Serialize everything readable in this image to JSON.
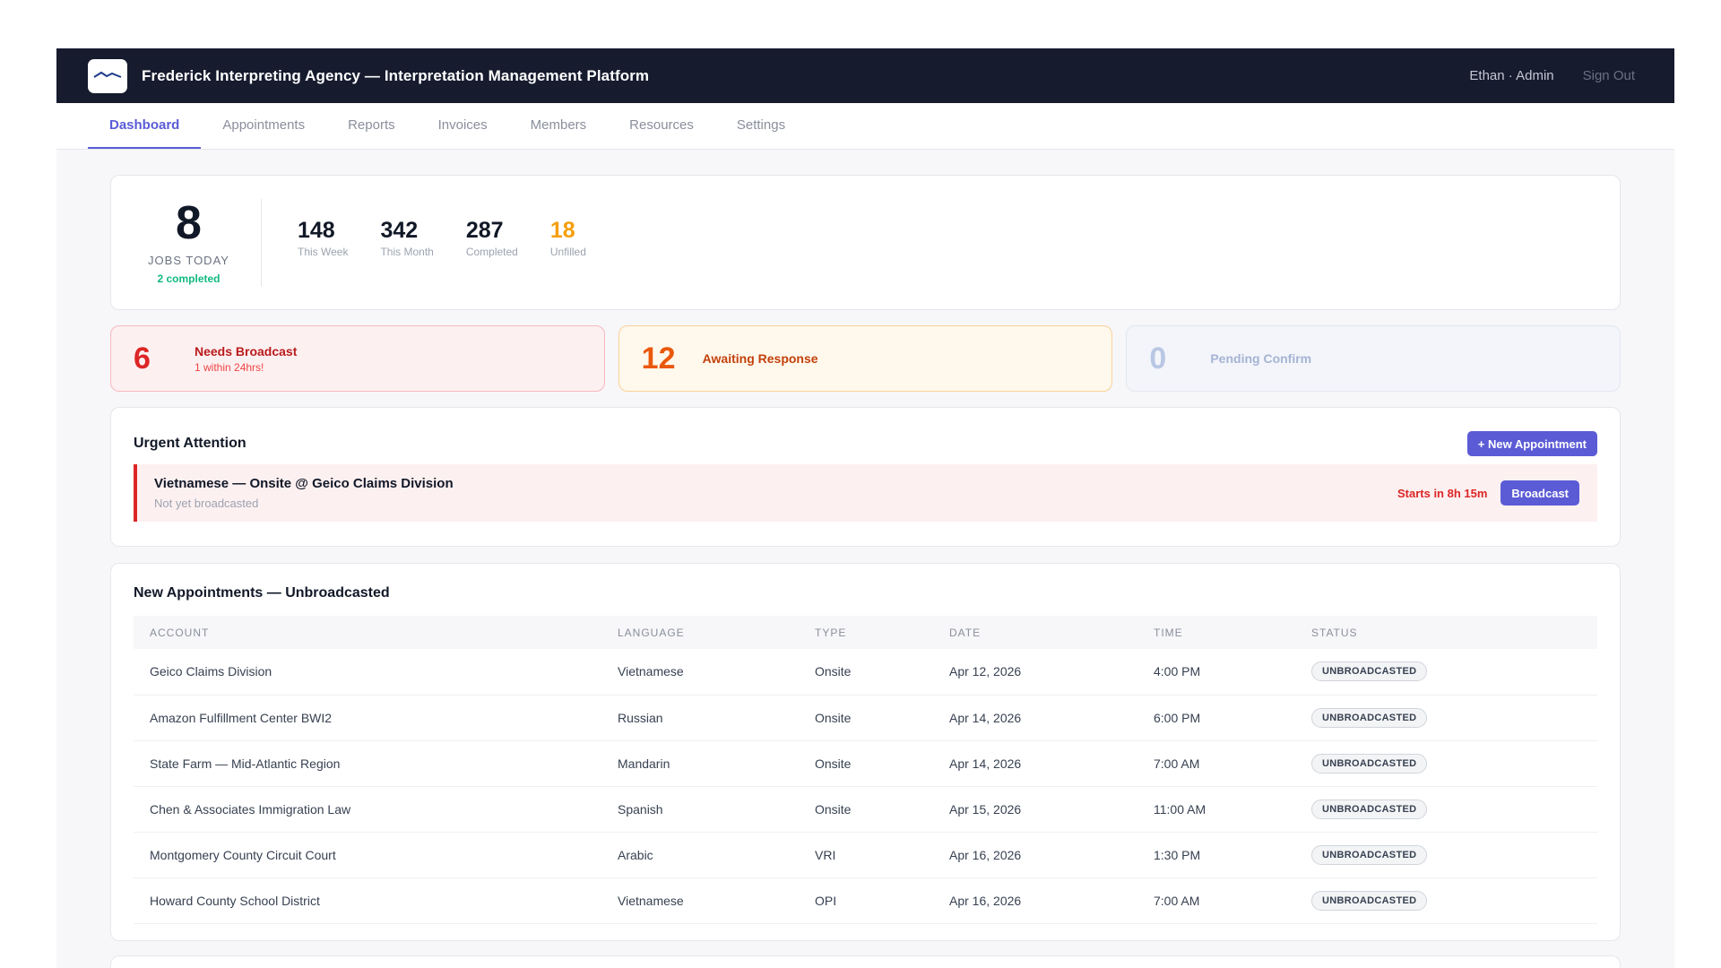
{
  "header": {
    "logo_icon": "agency-logo-icon",
    "title": "Frederick Interpreting Agency — Interpretation Management Platform",
    "user": "Ethan · Admin",
    "sign_out": "Sign Out"
  },
  "nav": {
    "tabs": [
      {
        "label": "Dashboard",
        "active": true
      },
      {
        "label": "Appointments"
      },
      {
        "label": "Reports"
      },
      {
        "label": "Invoices"
      },
      {
        "label": "Members"
      },
      {
        "label": "Resources"
      },
      {
        "label": "Settings"
      }
    ]
  },
  "stats": {
    "jobs_today": "8",
    "jobs_today_label": "JOBS TODAY",
    "completed_today": "2 completed",
    "this_week": "148",
    "this_week_label": "This Week",
    "this_month": "342",
    "this_month_label": "This Month",
    "completed": "287",
    "completed_label": "Completed",
    "unfilled": "18",
    "unfilled_label": "Unfilled"
  },
  "status_cards": {
    "needs_broadcast": {
      "count": "6",
      "title": "Needs Broadcast",
      "sub": "1 within 24hrs!"
    },
    "awaiting_response": {
      "count": "12",
      "title": "Awaiting Response"
    },
    "pending_confirm": {
      "count": "0",
      "title": "Pending Confirm"
    }
  },
  "urgent": {
    "title": "Urgent Attention",
    "new_button": "+ New Appointment",
    "item": {
      "title": "Vietnamese — Onsite @ Geico Claims Division",
      "sub": "Not yet broadcasted",
      "starts": "Starts in 8h 15m",
      "action": "Broadcast"
    }
  },
  "table": {
    "title": "New Appointments — Unbroadcasted",
    "columns": [
      "ACCOUNT",
      "LANGUAGE",
      "TYPE",
      "DATE",
      "TIME",
      "STATUS"
    ],
    "rows": [
      [
        "Geico Claims Division",
        "Vietnamese",
        "Onsite",
        "Apr 12, 2026",
        "4:00 PM",
        "UNBROADCASTED"
      ],
      [
        "Amazon Fulfillment Center BWI2",
        "Russian",
        "Onsite",
        "Apr 14, 2026",
        "6:00 PM",
        "UNBROADCASTED"
      ],
      [
        "State Farm — Mid-Atlantic Region",
        "Mandarin",
        "Onsite",
        "Apr 14, 2026",
        "7:00 AM",
        "UNBROADCASTED"
      ],
      [
        "Chen & Associates Immigration Law",
        "Spanish",
        "Onsite",
        "Apr 15, 2026",
        "11:00 AM",
        "UNBROADCASTED"
      ],
      [
        "Montgomery County Circuit Court",
        "Arabic",
        "VRI",
        "Apr 16, 2026",
        "1:30 PM",
        "UNBROADCASTED"
      ],
      [
        "Howard County School District",
        "Vietnamese",
        "OPI",
        "Apr 16, 2026",
        "7:00 AM",
        "UNBROADCASTED"
      ]
    ]
  },
  "colors": {
    "accent": "#5b5bd6",
    "header_bg": "#161b2e",
    "danger": "#dc2626",
    "warning": "#ea580c",
    "success": "#10b981"
  }
}
